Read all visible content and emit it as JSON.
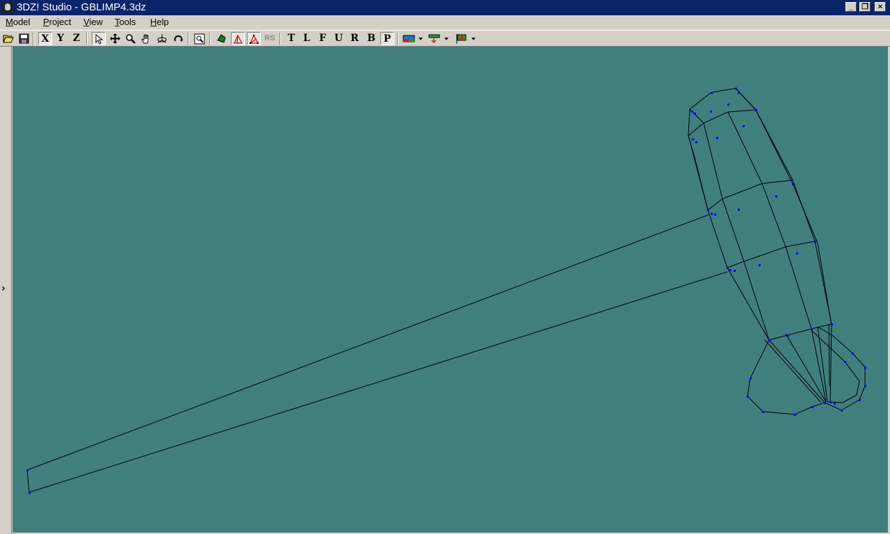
{
  "window": {
    "title": "3DZ! Studio - GBLIMP4.3dz",
    "minimize_label": "_",
    "restore_label": "❐",
    "close_label": "×"
  },
  "menu": {
    "items": [
      {
        "label": "Model",
        "underline": "M"
      },
      {
        "label": "Project",
        "underline": "P"
      },
      {
        "label": "View",
        "underline": "V"
      },
      {
        "label": "Tools",
        "underline": "T"
      },
      {
        "label": "Help",
        "underline": "H"
      }
    ]
  },
  "toolbar": {
    "axis_x": "X",
    "axis_y": "Y",
    "axis_z": "Z",
    "rs_label": "RS",
    "view_t": "T",
    "view_l": "L",
    "view_f": "F",
    "view_u": "U",
    "view_r": "R",
    "view_b": "B",
    "view_p": "P"
  },
  "left_panel": {
    "expand_glyph": "›"
  },
  "viewport": {
    "background": "#417f7f",
    "wire_color": "#000000",
    "vertex_color": "#0000ff"
  }
}
